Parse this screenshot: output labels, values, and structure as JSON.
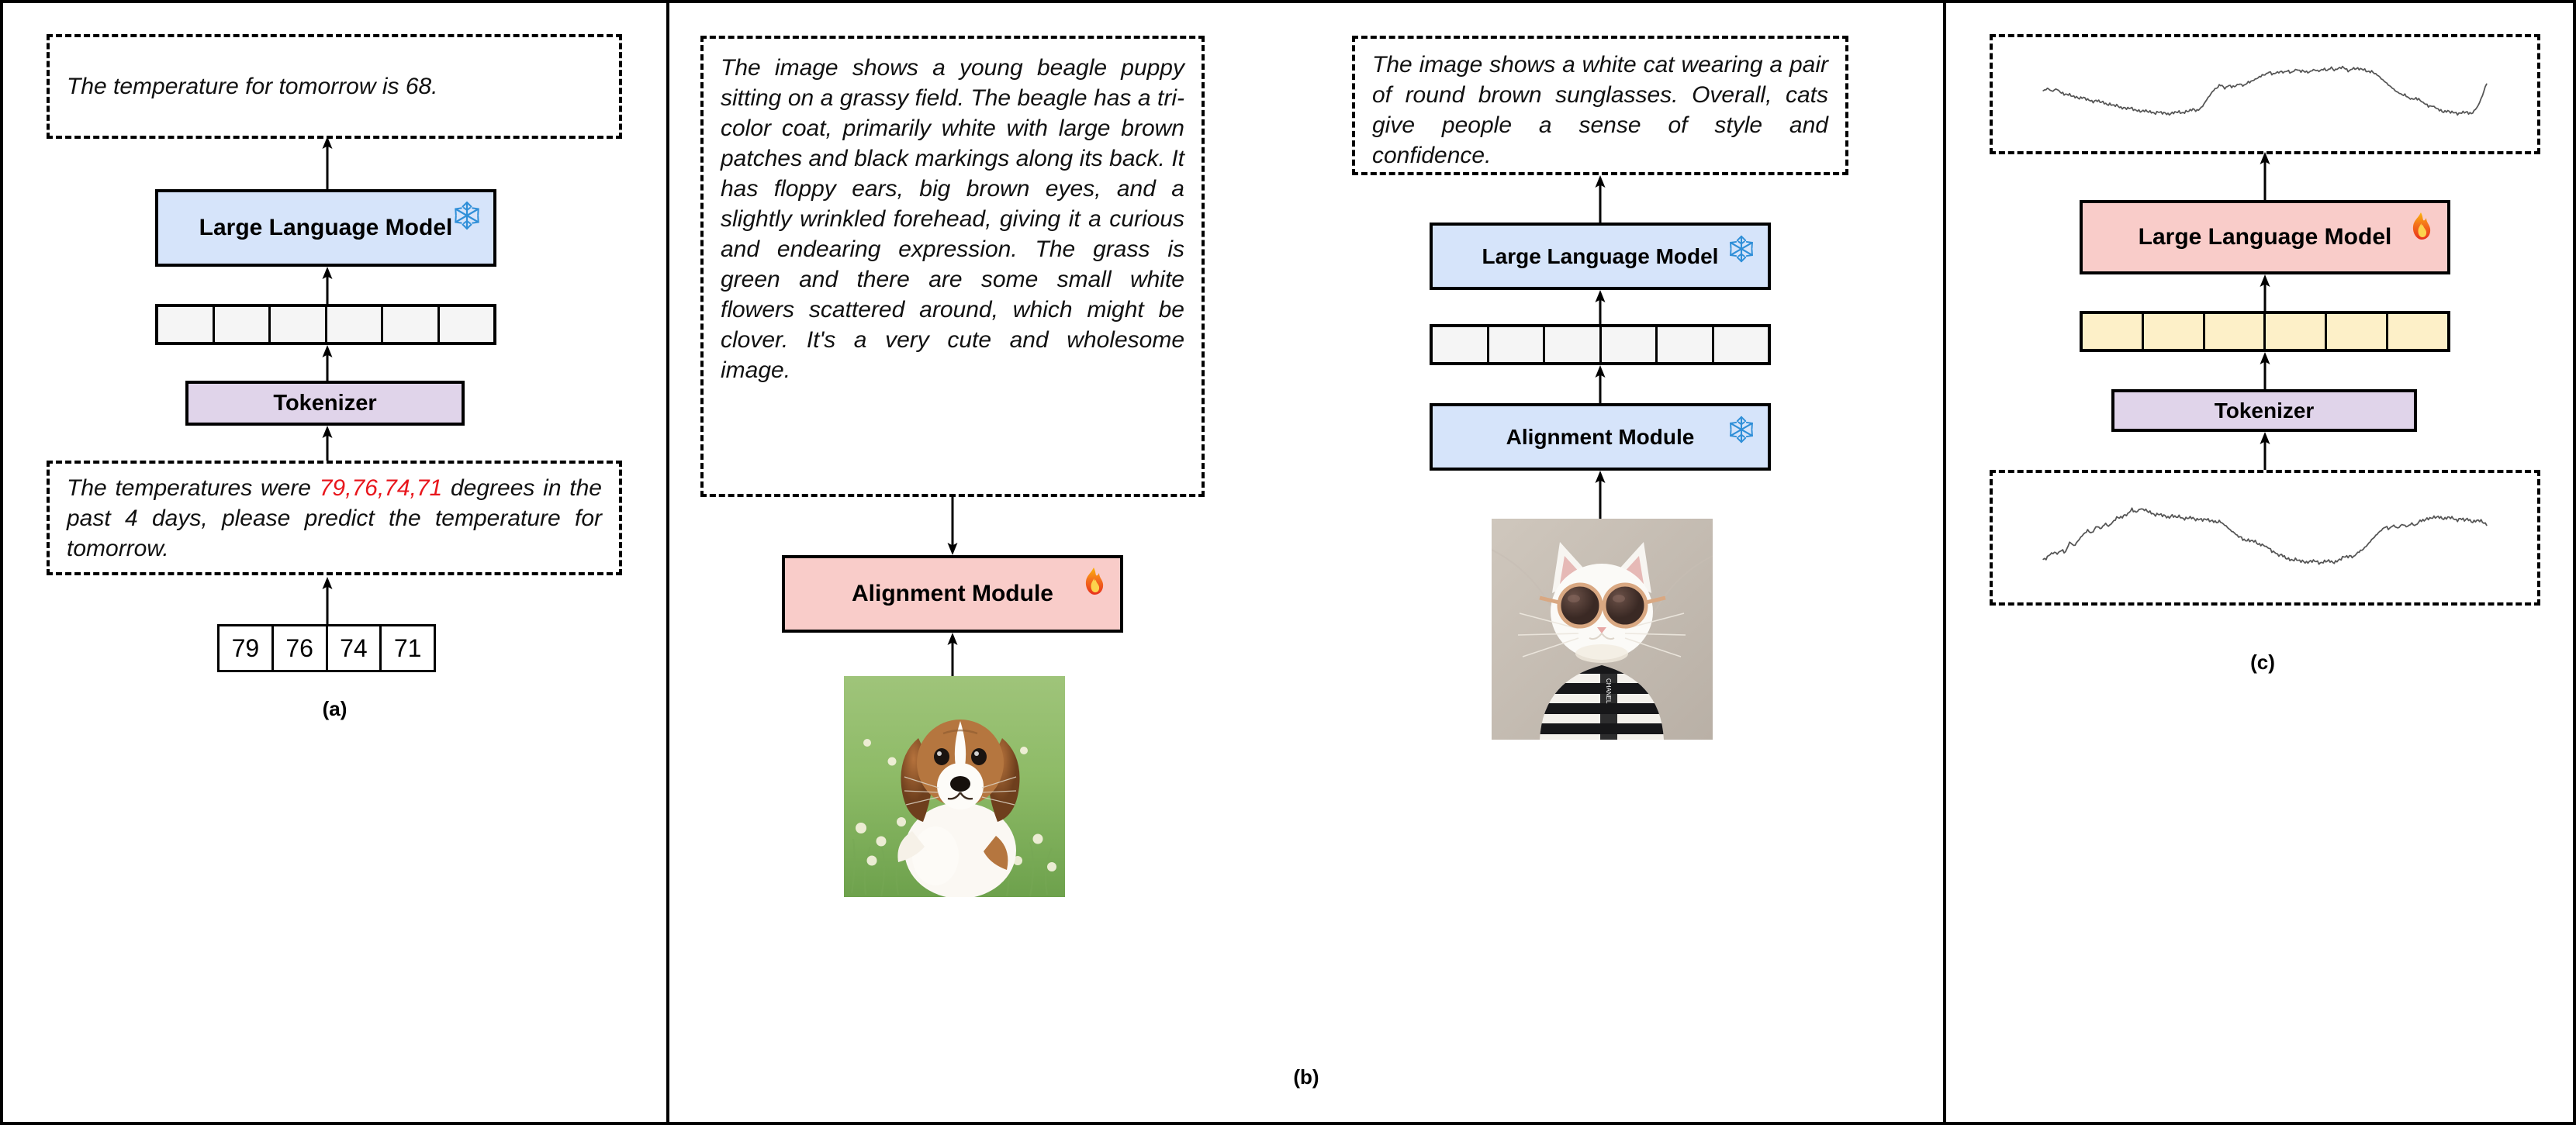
{
  "figure": {
    "panels": [
      {
        "id": "a",
        "label": "(a)",
        "output_text": "The temperature for tomorrow is 68.",
        "llm_label": "Large Language Model",
        "llm_state_icon": "snowflake-icon",
        "tokenizer_label": "Tokenizer",
        "prompt_prefix": "The temperatures were ",
        "prompt_values": "79,76,74,71",
        "prompt_suffix": " degrees in the past 4 days, please predict the temperature for tomorrow.",
        "input_values": [
          "79",
          "76",
          "74",
          "71"
        ],
        "token_count": 6
      },
      {
        "id": "b",
        "label": "(b)",
        "left": {
          "output_text": "The image shows a young beagle puppy sitting on a grassy field. The beagle has a tri-color coat, primarily white with large brown patches and black markings along its back. It has floppy ears, big brown eyes, and a slightly wrinkled forehead, giving it a curious and endearing expression. The grass is green and there are some small white flowers scattered around, which might be clover. It's a very cute and wholesome image.",
          "alignment_label": "Alignment Module",
          "alignment_state_icon": "fire-icon",
          "image_caption": "beagle-puppy-photo"
        },
        "right": {
          "output_text": "The image shows a white cat wearing a pair of round brown sunglasses. Overall, cats give people a sense of style and confidence.",
          "llm_label": "Large Language Model",
          "llm_state_icon": "snowflake-icon",
          "alignment_label": "Alignment Module",
          "alignment_state_icon": "snowflake-icon",
          "token_count": 6,
          "image_caption": "white-cat-sunglasses-photo"
        }
      },
      {
        "id": "c",
        "label": "(c)",
        "llm_label": "Large Language Model",
        "llm_state_icon": "fire-icon",
        "tokenizer_label": "Tokenizer",
        "token_count": 6
      }
    ]
  },
  "chart_data": [
    {
      "type": "line",
      "name": "panel-c-output-series",
      "title": "",
      "xlabel": "",
      "ylabel": "",
      "grid": false,
      "legend": null,
      "xlim": [
        0,
        100
      ],
      "ylim": [
        0,
        1
      ],
      "x": [
        0,
        1,
        2,
        3,
        4,
        5,
        6,
        7,
        8,
        9,
        10,
        11,
        12,
        13,
        14,
        15,
        16,
        17,
        18,
        19,
        20,
        21,
        22,
        23,
        24,
        25,
        26,
        27,
        28,
        29,
        30,
        31,
        32,
        33,
        34,
        35,
        36,
        37,
        38,
        39,
        40,
        41,
        42,
        43,
        44,
        45,
        46,
        47,
        48,
        49,
        50,
        51,
        52,
        53,
        54,
        55,
        56,
        57,
        58,
        59,
        60,
        61,
        62,
        63,
        64,
        65,
        66,
        67,
        68,
        69,
        70,
        71,
        72,
        73,
        74,
        75,
        76,
        77,
        78,
        79,
        80,
        81,
        82,
        83,
        84,
        85,
        86,
        87,
        88,
        89,
        90,
        91,
        92,
        93,
        94,
        95,
        96,
        97,
        98,
        99,
        100
      ],
      "y": [
        0.52,
        0.55,
        0.51,
        0.54,
        0.5,
        0.48,
        0.46,
        0.45,
        0.44,
        0.43,
        0.41,
        0.4,
        0.4,
        0.38,
        0.37,
        0.36,
        0.34,
        0.33,
        0.32,
        0.31,
        0.3,
        0.29,
        0.28,
        0.27,
        0.27,
        0.26,
        0.26,
        0.25,
        0.25,
        0.25,
        0.26,
        0.26,
        0.27,
        0.28,
        0.29,
        0.29,
        0.34,
        0.42,
        0.5,
        0.56,
        0.58,
        0.55,
        0.59,
        0.56,
        0.6,
        0.58,
        0.61,
        0.63,
        0.66,
        0.7,
        0.71,
        0.74,
        0.72,
        0.75,
        0.73,
        0.76,
        0.74,
        0.77,
        0.75,
        0.76,
        0.74,
        0.77,
        0.75,
        0.78,
        0.76,
        0.79,
        0.77,
        0.8,
        0.78,
        0.76,
        0.79,
        0.77,
        0.78,
        0.76,
        0.74,
        0.72,
        0.68,
        0.63,
        0.58,
        0.54,
        0.5,
        0.47,
        0.45,
        0.42,
        0.43,
        0.4,
        0.37,
        0.34,
        0.33,
        0.3,
        0.28,
        0.27,
        0.26,
        0.26,
        0.25,
        0.26,
        0.25,
        0.27,
        0.33,
        0.45,
        0.62
      ]
    },
    {
      "type": "line",
      "name": "panel-c-input-series",
      "title": "",
      "xlabel": "",
      "ylabel": "",
      "grid": false,
      "legend": null,
      "xlim": [
        0,
        100
      ],
      "ylim": [
        0,
        1
      ],
      "x": [
        0,
        1,
        2,
        3,
        4,
        5,
        6,
        7,
        8,
        9,
        10,
        11,
        12,
        13,
        14,
        15,
        16,
        17,
        18,
        19,
        20,
        21,
        22,
        23,
        24,
        25,
        26,
        27,
        28,
        29,
        30,
        31,
        32,
        33,
        34,
        35,
        36,
        37,
        38,
        39,
        40,
        41,
        42,
        43,
        44,
        45,
        46,
        47,
        48,
        49,
        50,
        51,
        52,
        53,
        54,
        55,
        56,
        57,
        58,
        59,
        60,
        61,
        62,
        63,
        64,
        65,
        66,
        67,
        68,
        69,
        70,
        71,
        72,
        73,
        74,
        75,
        76,
        77,
        78,
        79,
        80,
        81,
        82,
        83,
        84,
        85,
        86,
        87,
        88,
        89,
        90,
        91,
        92,
        93,
        94,
        95,
        96,
        97,
        98,
        99,
        100
      ],
      "y": [
        0.26,
        0.29,
        0.33,
        0.31,
        0.36,
        0.34,
        0.44,
        0.4,
        0.47,
        0.52,
        0.56,
        0.54,
        0.61,
        0.58,
        0.64,
        0.62,
        0.67,
        0.7,
        0.72,
        0.74,
        0.78,
        0.76,
        0.8,
        0.77,
        0.76,
        0.74,
        0.73,
        0.72,
        0.71,
        0.72,
        0.7,
        0.71,
        0.69,
        0.7,
        0.68,
        0.69,
        0.68,
        0.67,
        0.67,
        0.66,
        0.65,
        0.62,
        0.58,
        0.54,
        0.5,
        0.48,
        0.46,
        0.45,
        0.44,
        0.42,
        0.4,
        0.37,
        0.34,
        0.31,
        0.29,
        0.27,
        0.26,
        0.25,
        0.24,
        0.24,
        0.23,
        0.24,
        0.23,
        0.23,
        0.24,
        0.23,
        0.24,
        0.26,
        0.28,
        0.3,
        0.29,
        0.33,
        0.36,
        0.41,
        0.46,
        0.51,
        0.56,
        0.6,
        0.58,
        0.62,
        0.59,
        0.63,
        0.6,
        0.64,
        0.62,
        0.66,
        0.68,
        0.7,
        0.69,
        0.71,
        0.7,
        0.69,
        0.7,
        0.68,
        0.69,
        0.67,
        0.68,
        0.66,
        0.67,
        0.65,
        0.64
      ]
    }
  ]
}
